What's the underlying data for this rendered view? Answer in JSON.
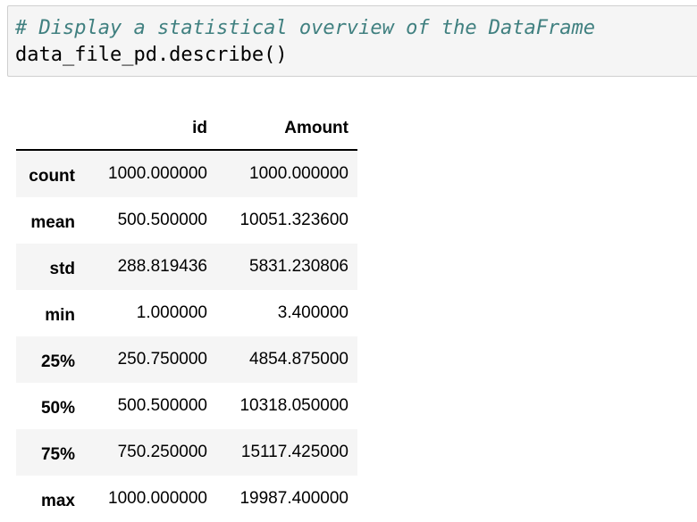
{
  "input_cell": {
    "comment": "# Display a statistical overview of the DataFrame",
    "code": "data_file_pd.describe()"
  },
  "output_table": {
    "columns": [
      "",
      "id",
      "Amount"
    ],
    "rows": [
      {
        "index": "count",
        "id": "1000.000000",
        "amount": "1000.000000"
      },
      {
        "index": "mean",
        "id": "500.500000",
        "amount": "10051.323600"
      },
      {
        "index": "std",
        "id": "288.819436",
        "amount": "5831.230806"
      },
      {
        "index": "min",
        "id": "1.000000",
        "amount": "3.400000"
      },
      {
        "index": "25%",
        "id": "250.750000",
        "amount": "4854.875000"
      },
      {
        "index": "50%",
        "id": "500.500000",
        "amount": "10318.050000"
      },
      {
        "index": "75%",
        "id": "750.250000",
        "amount": "15117.425000"
      },
      {
        "index": "max",
        "id": "1000.000000",
        "amount": "19987.400000"
      }
    ]
  },
  "colors": {
    "cell_background": "#f5f5f5",
    "cell_border": "#cfcfcf",
    "comment": "#408080",
    "row_stripe": "#f5f5f5"
  }
}
